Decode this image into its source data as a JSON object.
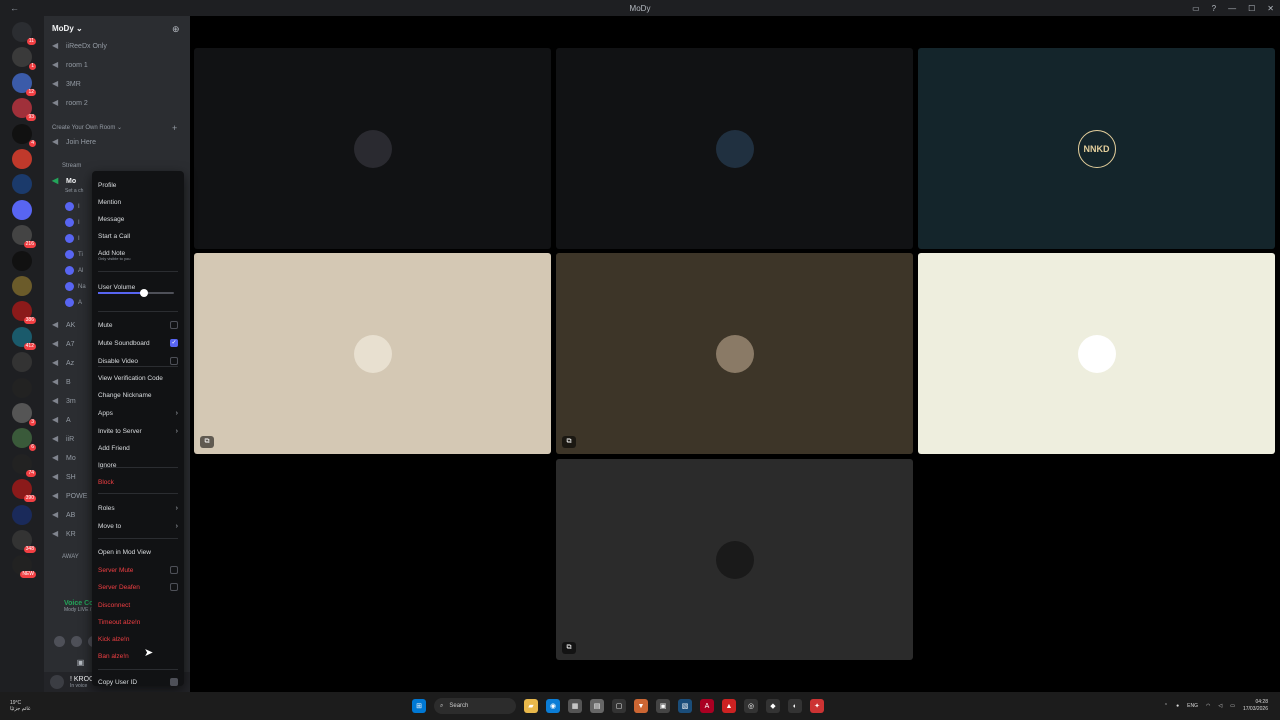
{
  "window": {
    "title": "MoDy",
    "back_glyph": "←",
    "minimize_glyph": "—",
    "maximize_glyph": "☐",
    "close_glyph": "✕"
  },
  "server_list": [
    {
      "color": "#2b2d31",
      "badge": "11"
    },
    {
      "color": "#3a3a3a",
      "badge": "1"
    },
    {
      "color": "#3b5ba9",
      "badge": "12"
    },
    {
      "color": "#a0303a",
      "badge": "93"
    },
    {
      "color": "#111",
      "badge": "4"
    },
    {
      "color": "#c0392b",
      "badge": ""
    },
    {
      "color": "#1b3a6b",
      "badge": ""
    },
    {
      "color": "#5865f2",
      "badge": ""
    },
    {
      "color": "#444",
      "badge": "216"
    },
    {
      "color": "#111",
      "badge": ""
    },
    {
      "color": "#6b5b2a",
      "badge": ""
    },
    {
      "color": "#8b1a1a",
      "badge": "386"
    },
    {
      "color": "#1a5a6b",
      "badge": "412"
    },
    {
      "color": "#333",
      "badge": ""
    },
    {
      "color": "#222",
      "badge": ""
    },
    {
      "color": "#555",
      "badge": "3"
    },
    {
      "color": "#3a5a3a",
      "badge": "6"
    },
    {
      "color": "#222",
      "badge": "74"
    },
    {
      "color": "#8b1a1a",
      "badge": "390"
    },
    {
      "color": "#1a2a5a",
      "badge": ""
    },
    {
      "color": "#333",
      "badge": "348"
    },
    {
      "color": "#222",
      "badge": "NEW"
    }
  ],
  "sidebar": {
    "server_name": "MoDy",
    "channels_top": [
      {
        "label": "iiReeDx Only"
      },
      {
        "label": "room 1"
      },
      {
        "label": "3MR"
      },
      {
        "label": "room 2"
      }
    ],
    "category": "Create Your Own Room",
    "join_here": "Join Here",
    "stream_category": "Stream",
    "active_channel": "Mo",
    "active_sub": "Set a ch",
    "members": [
      "I",
      "I",
      "I",
      "Ti",
      "Al",
      "Na",
      "A"
    ],
    "channels_bottom": [
      {
        "label": "AK"
      },
      {
        "label": "A7"
      },
      {
        "label": "Az"
      },
      {
        "label": "B"
      },
      {
        "label": "3m"
      },
      {
        "label": "A"
      },
      {
        "label": "iiR"
      },
      {
        "label": "Mo"
      },
      {
        "label": "SH"
      },
      {
        "label": "POWE"
      },
      {
        "label": "AB"
      },
      {
        "label": "KR"
      }
    ],
    "away_category": "AWAY",
    "voice_connected": "Voice Connected",
    "voice_sub": "Mody LIVE / MoDy",
    "user_name": "! KROOS",
    "user_status": "In voice"
  },
  "context_menu": {
    "items": [
      {
        "label": "Profile",
        "type": "item"
      },
      {
        "label": "Mention",
        "type": "item"
      },
      {
        "label": "Message",
        "type": "item"
      },
      {
        "label": "Start a Call",
        "type": "item"
      },
      {
        "label": "Add Note",
        "sub": "Only visible to you",
        "type": "item"
      },
      {
        "label": "User Volume",
        "type": "label"
      },
      {
        "label": "Mute",
        "type": "check",
        "checked": false
      },
      {
        "label": "Mute Soundboard",
        "type": "check",
        "checked": true
      },
      {
        "label": "Disable Video",
        "type": "check",
        "checked": false
      },
      {
        "label": "View Verification Code",
        "type": "item"
      },
      {
        "label": "Change Nickname",
        "type": "item"
      },
      {
        "label": "Apps",
        "type": "submenu"
      },
      {
        "label": "Invite to Server",
        "type": "submenu"
      },
      {
        "label": "Add Friend",
        "type": "item"
      },
      {
        "label": "Ignore",
        "type": "item"
      },
      {
        "label": "Block",
        "type": "danger"
      },
      {
        "label": "Roles",
        "type": "submenu"
      },
      {
        "label": "Move to",
        "type": "submenu"
      },
      {
        "label": "Open in Mod View",
        "type": "item"
      },
      {
        "label": "Server Mute",
        "type": "danger-check"
      },
      {
        "label": "Server Deafen",
        "type": "danger-check"
      },
      {
        "label": "Disconnect",
        "type": "danger"
      },
      {
        "label": "Timeout alze!n",
        "type": "danger"
      },
      {
        "label": "Kick alze!n",
        "type": "danger"
      },
      {
        "label": "Ban alze!n",
        "type": "danger"
      },
      {
        "label": "Copy User ID",
        "type": "item"
      }
    ],
    "volume": 0.6
  },
  "tiles": [
    {
      "bg": "#111214",
      "avatar_bg": "#2a2a30",
      "text": ""
    },
    {
      "bg": "#111214",
      "avatar_bg": "#203040",
      "text": ""
    },
    {
      "bg": "#14252b",
      "avatar_bg": "#14252b",
      "text": "NNKD"
    },
    {
      "bg": "#d4c8b4",
      "avatar_bg": "#e8e0d0",
      "text": ""
    },
    {
      "bg": "#3d3528",
      "avatar_bg": "#8a7a66",
      "text": ""
    },
    {
      "bg": "#eeeede",
      "avatar_bg": "#ffffff",
      "text": ""
    },
    {
      "bg": "#2b2b2b",
      "avatar_bg": "#1a1a1a",
      "text": ""
    }
  ],
  "taskbar": {
    "weather_temp": "19°C",
    "weather_desc": "غائم جزئيًا",
    "search_label": "Search",
    "lang": "ENG",
    "time": "04:28",
    "date": "17/03/2026"
  }
}
